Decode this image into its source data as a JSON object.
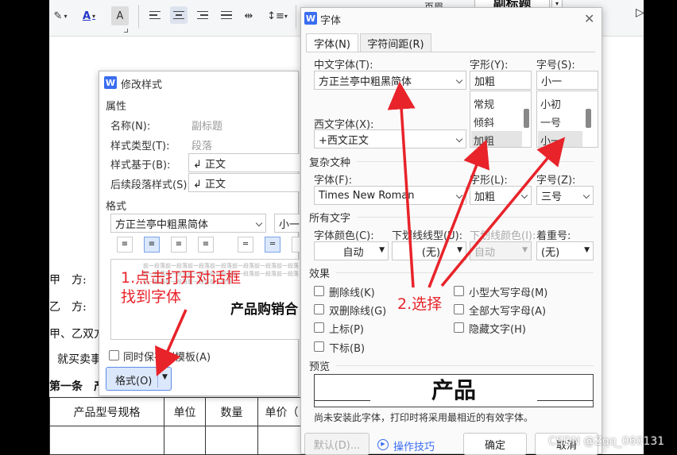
{
  "ribbon": {
    "header_footer_label": "页眉",
    "subtitle_style": "副标题"
  },
  "document": {
    "party_a": "甲　方:",
    "party_b": "乙　方:",
    "both_parties": "甲、乙双方",
    "purchase_text": "就买卖事",
    "article_one": "第一条　产",
    "table_headers": [
      "产品型号规格",
      "单位",
      "数量",
      "单价（"
    ]
  },
  "modify_dialog": {
    "title": "修改样式",
    "properties_label": "属性",
    "name_label": "名称(N):",
    "name_value": "副标题",
    "type_label": "样式类型(T):",
    "type_value": "段落",
    "based_label": "样式基于(B):",
    "based_value": "↲ 正文",
    "next_label": "后续段落样式(S):",
    "next_value": "↲ 正文",
    "format_label": "格式",
    "font_value": "方正兰亭中粗黑简体",
    "size_value": "小一",
    "preview_small": "前一段落前一段落前一段落前一段落前一段落前一段落前一段落前一段落前一段落前一段落前一段落前一段落前一段落前一段落前一段落前一段落前一段落前一段落",
    "preview_big": "产品购销合",
    "save_template": "同时保存到模板(A)",
    "format_button": "格式(O)"
  },
  "font_dialog": {
    "title": "字体",
    "tabs": [
      "字体(N)",
      "字符间距(R)"
    ],
    "cn_font_label": "中文字体(T):",
    "cn_font_value": "方正兰亭中粗黑简体",
    "style_label": "字形(Y):",
    "style_value": "加粗",
    "style_options": [
      "常规",
      "倾斜",
      "加粗"
    ],
    "size_label": "字号(S):",
    "size_value": "小一",
    "size_options": [
      "小初",
      "一号",
      "小一"
    ],
    "west_font_label": "西文字体(X):",
    "west_font_value": "+西文正文",
    "complex_label": "复杂文种",
    "complex_font_label": "字体(F):",
    "complex_font_value": "Times New Roman",
    "complex_style_label": "字形(L):",
    "complex_style_value": "加粗",
    "complex_size_label": "字号(Z):",
    "complex_size_value": "三号",
    "all_text_label": "所有文字",
    "color_label": "字体颜色(C):",
    "color_value": "自动",
    "underline_label": "下划线线型(U):",
    "underline_value": "(无)",
    "underline_color_label": "下划线颜色(I):",
    "underline_color_value": "自动",
    "emphasis_label": "着重号:",
    "emphasis_value": "(无)",
    "effects_label": "效果",
    "effects_left": [
      "删除线(K)",
      "双删除线(G)",
      "上标(P)",
      "下标(B)"
    ],
    "effects_right": [
      "小型大写字母(M)",
      "全部大写字母(A)",
      "隐藏文字(H)"
    ],
    "preview_label": "预览",
    "preview_text": "产品",
    "note": "尚未安装此字体，打印时将采用最相近的有效字体。",
    "default_button": "默认(D)...",
    "tips_button": "操作技巧",
    "ok_button": "确定",
    "cancel_button": "取消"
  },
  "annotations": {
    "step1": "1.点击打开对话框\n找到字体",
    "step2": "2.选择"
  },
  "watermark": "CSDN @Zqq_060131"
}
